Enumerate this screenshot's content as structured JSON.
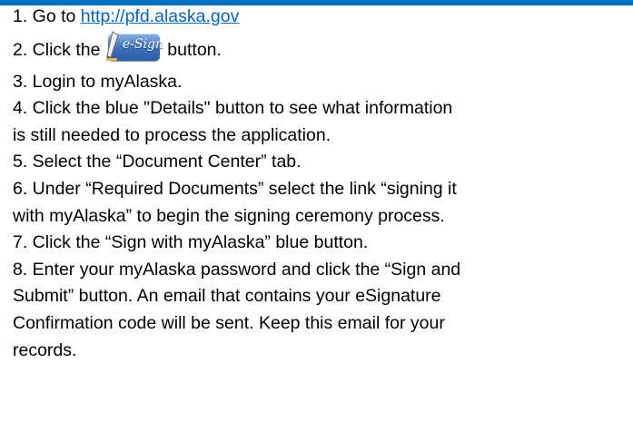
{
  "header_bar_color": "#0070c0",
  "link_color": "#0563c1",
  "steps": [
    {
      "before": "1. Go to ",
      "link": "http://pfd.alaska.gov"
    },
    {
      "before": "2. Click the ",
      "button_label": "e-Sign",
      "after": " button."
    },
    {
      "text": "3. Login to myAlaska."
    },
    {
      "text": "4. Click the blue \"Details\" button to see what information"
    },
    {
      "text": "is still needed to process the application."
    },
    {
      "text": "5. Select the “Document Center” tab."
    },
    {
      "text": "6. Under “Required Documents” select the link “signing it"
    },
    {
      "text": "with myAlaska” to begin the signing ceremony process."
    },
    {
      "text": "7. Click the “Sign with myAlaska” blue button."
    },
    {
      "text": "8. Enter your myAlaska password and click the “Sign and"
    },
    {
      "text": "Submit” button. An email that contains your eSignature"
    },
    {
      "text": "Confirmation code will be sent.  Keep this email for your"
    },
    {
      "text": "records."
    }
  ]
}
